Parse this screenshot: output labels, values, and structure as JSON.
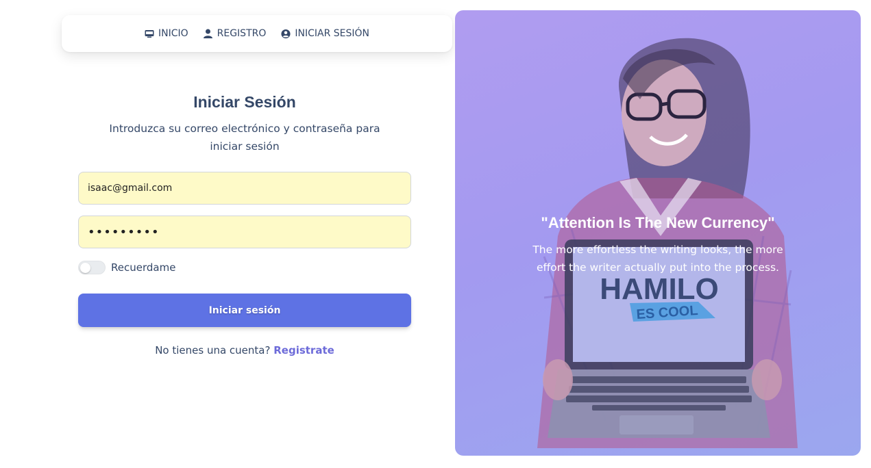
{
  "nav": {
    "items": [
      {
        "label": "INICIO",
        "icon": "dashboard-icon"
      },
      {
        "label": "REGISTRO",
        "icon": "user-icon"
      },
      {
        "label": "INICIAR SESIÓN",
        "icon": "user-circle-icon"
      }
    ]
  },
  "form": {
    "title": "Iniciar Sesión",
    "subtitle": "Introduzca su correo electrónico y contraseña para iniciar sesión",
    "email_value": "isaac@gmail.com",
    "password_masked": "•••••••••",
    "remember_label": "Recuerdame",
    "remember_checked": false,
    "submit_label": "Iniciar sesión",
    "signup_prompt": "No tienes una cuenta?",
    "signup_link": "Registrate"
  },
  "hero": {
    "quote": "\"Attention Is The New Currency\"",
    "text": "The more effortless the writing looks, the more effort the writer actually put into the process.",
    "laptop_brand": "HAMILO",
    "laptop_tagline": "ES COOL"
  },
  "colors": {
    "primary": "#5e72e4",
    "link": "#6d6bd9",
    "input_bg": "#fefac8",
    "text": "#344767",
    "hero_overlay": "#a39af0"
  }
}
